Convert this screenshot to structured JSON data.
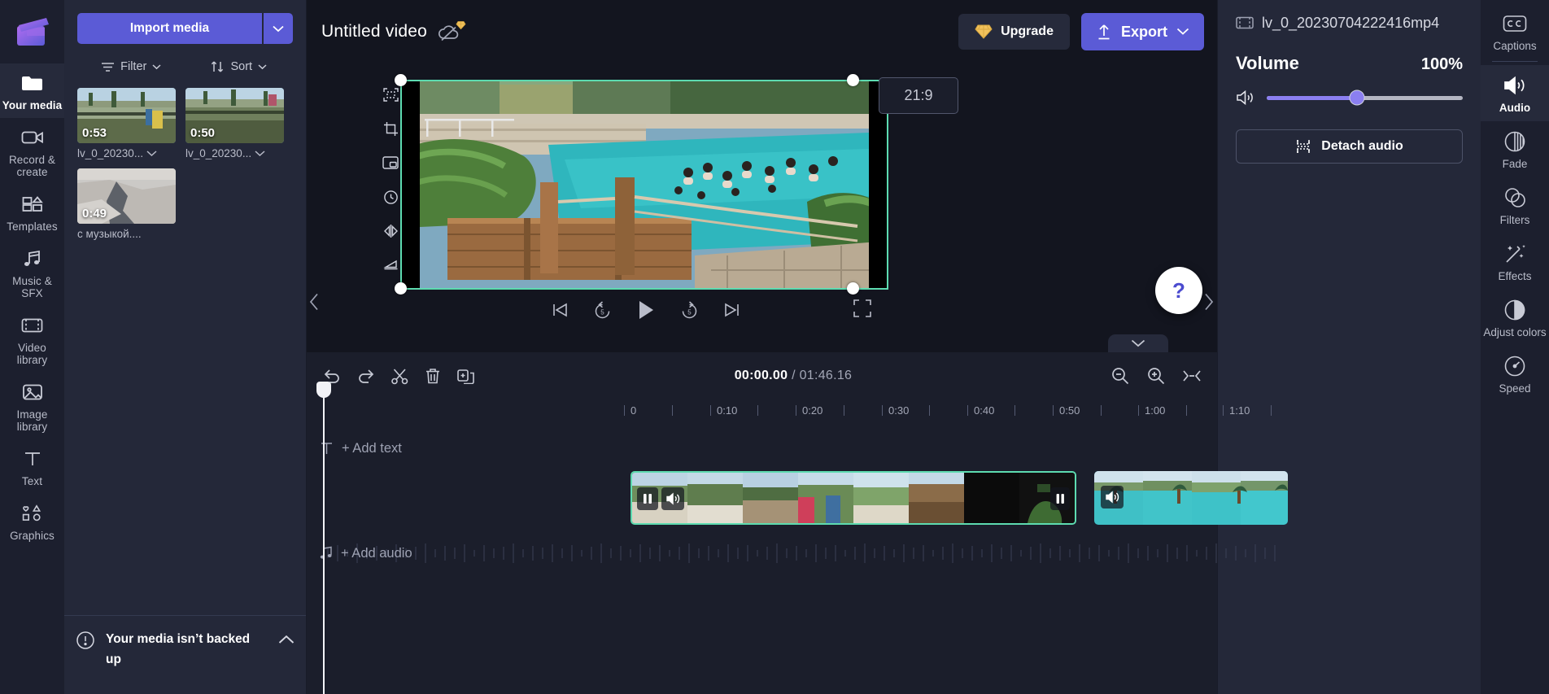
{
  "app": {
    "logo": "clipchamp-logo"
  },
  "left_rail": {
    "items": [
      {
        "label": "Your media",
        "icon": "folder-icon",
        "active": true
      },
      {
        "label": "Record & create",
        "icon": "camera-icon",
        "active": false
      },
      {
        "label": "Templates",
        "icon": "templates-icon",
        "active": false
      },
      {
        "label": "Music & SFX",
        "icon": "music-note-icon",
        "active": false
      },
      {
        "label": "Video library",
        "icon": "film-strip-icon",
        "active": false
      },
      {
        "label": "Image library",
        "icon": "image-icon",
        "active": false
      },
      {
        "label": "Text",
        "icon": "text-t-icon",
        "active": false
      },
      {
        "label": "Graphics",
        "icon": "shapes-icon",
        "active": false
      }
    ]
  },
  "media_panel": {
    "import_label": "Import media",
    "import_caret_icon": "chevron-down-icon",
    "filter_label": "Filter",
    "filter_icon": "filter-icon",
    "sort_label": "Sort",
    "sort_icon": "sort-arrows-icon",
    "items": [
      {
        "name": "lv_0_20230...",
        "duration": "0:53",
        "thumb": "pool-garden"
      },
      {
        "name": "lv_0_20230...",
        "duration": "0:50",
        "thumb": "pool-garden-2"
      },
      {
        "name": "с музыкой....",
        "duration": "0:49",
        "thumb": "rock-terrace"
      }
    ],
    "backup_notice": "Your media isn’t backed up",
    "backup_icon": "alert-circle-icon",
    "backup_caret_icon": "chevron-up-icon"
  },
  "topbar": {
    "video_title": "Untitled video",
    "cloud_status_icon": "cloud-off-icon",
    "cloud_badge_icon": "diamond-icon",
    "upgrade_label": "Upgrade",
    "upgrade_icon": "diamond-icon",
    "export_label": "Export",
    "export_icon": "upload-arrow-icon",
    "export_caret_icon": "chevron-down-icon"
  },
  "preview": {
    "aspect_ratio": "21:9",
    "tools": [
      {
        "name": "fit-to-frame",
        "icon": "fit-frame-icon"
      },
      {
        "name": "crop",
        "icon": "crop-icon"
      },
      {
        "name": "picture-in-picture",
        "icon": "pip-icon"
      },
      {
        "name": "rotate",
        "icon": "rotate-icon"
      },
      {
        "name": "flip-horizontal",
        "icon": "flip-horizontal-icon"
      },
      {
        "name": "flip-vertical",
        "icon": "flip-vertical-icon"
      }
    ],
    "transport": [
      {
        "name": "skip-to-start",
        "icon": "skip-start-icon"
      },
      {
        "name": "rewind-5",
        "icon": "rewind-5-icon"
      },
      {
        "name": "play",
        "icon": "play-icon"
      },
      {
        "name": "forward-5",
        "icon": "forward-5-icon"
      },
      {
        "name": "skip-to-end",
        "icon": "skip-end-icon"
      }
    ],
    "fullscreen_icon": "fullscreen-icon",
    "help_label": "?",
    "prev_icon": "chevron-left-icon",
    "next_icon": "chevron-right-icon",
    "collapse_icon": "chevron-down-icon"
  },
  "timeline": {
    "tools": [
      {
        "name": "undo",
        "icon": "undo-icon"
      },
      {
        "name": "redo",
        "icon": "redo-icon"
      },
      {
        "name": "split",
        "icon": "scissors-icon"
      },
      {
        "name": "delete",
        "icon": "trash-icon"
      },
      {
        "name": "duplicate",
        "icon": "duplicate-icon"
      }
    ],
    "current_time": "00:00.00",
    "separator": "/",
    "total_time": "01:46.16",
    "right_tools": [
      {
        "name": "zoom-out",
        "icon": "zoom-out-icon"
      },
      {
        "name": "zoom-in",
        "icon": "zoom-in-icon"
      },
      {
        "name": "fit-timeline",
        "icon": "fit-timeline-icon"
      }
    ],
    "ruler_ticks": [
      "0",
      "0:10",
      "0:20",
      "0:30",
      "0:40",
      "0:50",
      "1:00",
      "1:10"
    ],
    "add_text_label": "+ Add text",
    "add_text_icon": "text-t-icon",
    "add_audio_label": "+ Add audio",
    "add_audio_icon": "music-note-icon",
    "clips": [
      {
        "name": "clip-1",
        "selected": true,
        "pause_icon": "pause-icon",
        "audio_icon": "speaker-icon"
      },
      {
        "name": "clip-2",
        "selected": false,
        "audio_icon": "speaker-icon"
      }
    ]
  },
  "properties": {
    "file_icon": "film-strip-icon",
    "file_name": "lv_0_20230704222416mp4",
    "volume_label": "Volume",
    "volume_value": "100%",
    "volume_icon": "speaker-icon",
    "detach_label": "Detach audio",
    "detach_icon": "detach-icon"
  },
  "right_rail": {
    "items": [
      {
        "label": "Captions",
        "icon": "cc-icon",
        "active": false
      },
      {
        "label": "Audio",
        "icon": "speaker-icon",
        "active": true
      },
      {
        "label": "Fade",
        "icon": "fade-icon",
        "active": false
      },
      {
        "label": "Filters",
        "icon": "filters-circles-icon",
        "active": false
      },
      {
        "label": "Effects",
        "icon": "magic-wand-icon",
        "active": false
      },
      {
        "label": "Adjust colors",
        "icon": "contrast-icon",
        "active": false
      },
      {
        "label": "Speed",
        "icon": "speedometer-icon",
        "active": false
      }
    ]
  },
  "colors": {
    "accent": "#5b5bd6",
    "selection": "#5ddbb0",
    "panel": "#242839",
    "rail": "#1c1f2e",
    "canvas": "#13151f",
    "gold": "#f2c25c",
    "slider": "#8b7ff0"
  }
}
